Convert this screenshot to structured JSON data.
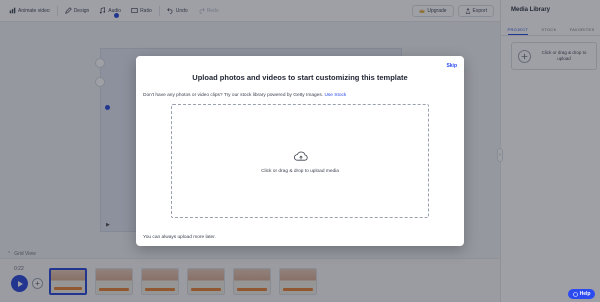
{
  "toolbar": {
    "items": [
      {
        "label": "Animate video"
      },
      {
        "label": "Design"
      },
      {
        "label": "Audio"
      },
      {
        "label": "Ratio"
      },
      {
        "label": "Undo"
      },
      {
        "label": "Redo"
      }
    ],
    "upgrade_label": "Upgrade",
    "export_label": "Export"
  },
  "editor": {
    "grid_view_label": "Grid View",
    "time_label": "0:22",
    "add_symbol": "+",
    "clips": [
      {
        "active": true
      },
      {
        "active": false
      },
      {
        "active": false
      },
      {
        "active": false
      },
      {
        "active": false
      },
      {
        "active": false
      }
    ]
  },
  "media_panel": {
    "title": "Media Library",
    "tabs": [
      {
        "label": "PROJECT",
        "active": true
      },
      {
        "label": "STOCK",
        "active": false
      },
      {
        "label": "FAVORITES",
        "active": false
      }
    ],
    "upload_text": "Click or drag & drop to upload",
    "collapse_symbol": "›"
  },
  "help": {
    "label": "Help"
  },
  "modal": {
    "skip_label": "Skip",
    "title": "Upload photos and videos to start customizing this template",
    "subtitle": "Don't have any photos or video clips? Try our stock library powered by Getty Images.",
    "subtitle_link": "Use Stock",
    "dropzone_text": "Click or drag & drop to upload media",
    "footer": "You can always upload more later."
  },
  "colors": {
    "accent": "#2b4bf0",
    "overlay": "rgba(40, 44, 55, 0.45)"
  }
}
